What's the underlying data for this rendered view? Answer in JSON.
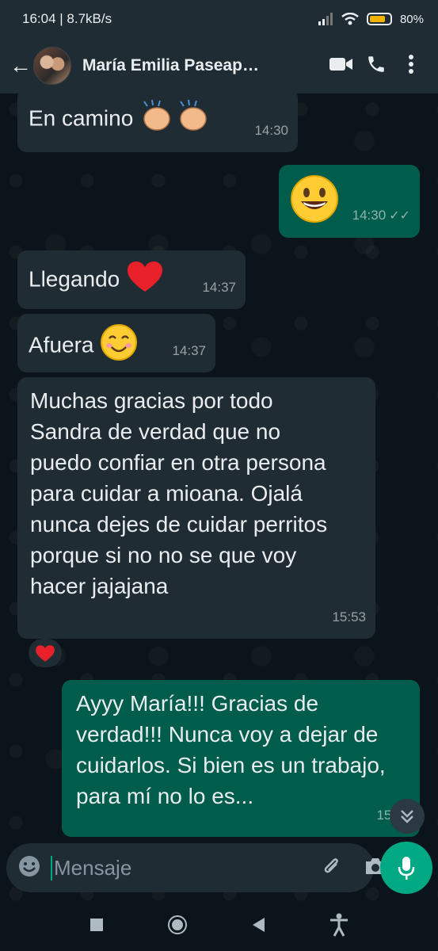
{
  "status_bar": {
    "time_speed": "16:04 | 8.7kB/s",
    "battery": "80%",
    "battery_level": 0.8
  },
  "header": {
    "contact_name": "María Emilia Paseap…"
  },
  "messages": [
    {
      "text": "En camino",
      "time": "14:30"
    },
    {
      "text": "",
      "time": "14:30"
    },
    {
      "text": "Llegando",
      "time": "14:37"
    },
    {
      "text": "Afuera",
      "time": "14:37"
    },
    {
      "text": "Muchas gracias por todo Sandra de verdad que no puedo confiar en otra persona para cuidar a mioana. Ojalá nunca dejes de cuidar perritos porque si no no se que voy hacer jajajana",
      "time": "15:53"
    },
    {
      "text": "Ayyy María!!! Gracias de verdad!!! Nunca voy a dejar de cuidarlos. Si bien es un trabajo, para mí no lo es...",
      "time": "15:55"
    }
  ],
  "input": {
    "placeholder": "Mensaje"
  },
  "colors": {
    "incoming": "#202c33",
    "outgoing": "#005c4b",
    "accent": "#00a884",
    "header": "#1f2c34"
  }
}
